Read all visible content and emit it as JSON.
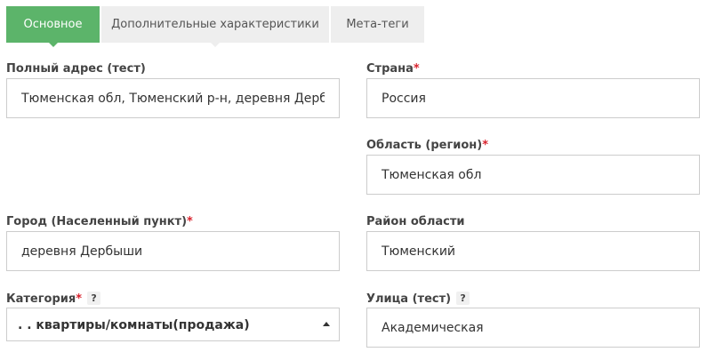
{
  "tabs": [
    {
      "label": "Основное",
      "active": true
    },
    {
      "label": "Дополнительные характеристики",
      "active": false
    },
    {
      "label": "Мета-теги",
      "active": false
    }
  ],
  "fields": {
    "full_address": {
      "label": "Полный адрес (тест)",
      "value": "Тюменская обл, Тюменский р-н, деревня Дербыши"
    },
    "country": {
      "label": "Страна",
      "value": "Россия"
    },
    "region": {
      "label": "Область (регион)",
      "value": "Тюменская обл"
    },
    "city": {
      "label": "Город (Населенный пункт)",
      "value": "деревня Дербыши"
    },
    "district": {
      "label": "Район области",
      "value": "Тюменский"
    },
    "category": {
      "label": "Категория",
      "value": ". . квартиры/комнаты(продажа)"
    },
    "street": {
      "label": "Улица (тест)",
      "value": "Академическая"
    }
  },
  "required_mark": "*",
  "help_mark": "?",
  "colors": {
    "accent": "#5cb46a",
    "required": "#d9232e",
    "tab_bg": "#eeeeee",
    "border": "#cccccc"
  }
}
